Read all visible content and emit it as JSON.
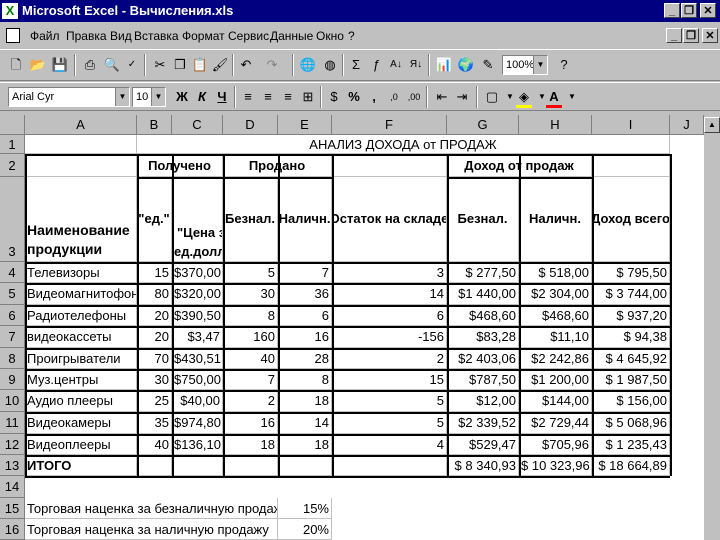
{
  "window": {
    "title": "Microsoft Excel - Вычисления.xls",
    "app_glyph": "X"
  },
  "window_buttons": {
    "minimize": "_",
    "restore": "❐",
    "close": "✕"
  },
  "menu": {
    "items": [
      "Файл",
      "Правка",
      "Вид",
      "Вставка",
      "Формат",
      "Сервис",
      "Данные",
      "Окно",
      "?"
    ]
  },
  "toolbar": {
    "zoom": "100%",
    "icons": [
      "new-icon",
      "open-icon",
      "save-icon",
      "print-icon",
      "preview-icon",
      "spelling-icon",
      "cut-icon",
      "copy-icon",
      "paste-icon",
      "format-painter-icon",
      "undo-icon",
      "redo-icon",
      "hyperlink-icon",
      "web-toolbar-icon",
      "autosum-icon",
      "function-icon",
      "sort-ascending-icon",
      "sort-descending-icon",
      "chart-wizard-icon",
      "map-icon",
      "drawing-icon",
      "help-icon"
    ]
  },
  "format": {
    "font": "Arial Cyr",
    "size": "10",
    "bold": "Ж",
    "italic": "К",
    "underline": "Ч",
    "percent": "%",
    "comma": ",",
    "fill_color": "#ffff00",
    "font_color": "#ff0000"
  },
  "columns": [
    "A",
    "B",
    "C",
    "D",
    "E",
    "F",
    "G",
    "H",
    "I",
    "J"
  ],
  "rows": [
    "1",
    "2",
    "3",
    "4",
    "5",
    "6",
    "7",
    "8",
    "9",
    "10",
    "11",
    "12",
    "13",
    "14",
    "15",
    "16"
  ],
  "sheet": {
    "title": "АНАЛИЗ ДОХОДА от ПРОДАЖ",
    "group_received": "Получено",
    "group_sold": "Продано",
    "group_income": "Доход от продаж",
    "h_name": "Наименование продукции",
    "h_units": "\"ед.\"",
    "h_price": "\"Цена за ед.долл.\"",
    "h_cashless": "Безнал.",
    "h_cash": "Наличн.",
    "h_stock": "Остаток на складе",
    "h_inc_cashless": "Безнал.",
    "h_inc_cash": "Наличн.",
    "h_total": "Доход всего",
    "products": [
      {
        "name": "Телевизоры",
        "units": "15",
        "price": "$370,00",
        "cashless": "5",
        "cash": "7",
        "stock": "3",
        "inc_cashless": "$ 277,50",
        "inc_cash": "$ 518,00",
        "total": "$ 795,50"
      },
      {
        "name": "Видеомагнитофоны",
        "units": "80",
        "price": "$320,00",
        "cashless": "30",
        "cash": "36",
        "stock": "14",
        "inc_cashless": "$1 440,00",
        "inc_cash": "$2 304,00",
        "total": "$ 3 744,00"
      },
      {
        "name": "Радиотелефоны",
        "units": "20",
        "price": "$390,50",
        "cashless": "8",
        "cash": "6",
        "stock": "6",
        "inc_cashless": "$468,60",
        "inc_cash": "$468,60",
        "total": "$ 937,20"
      },
      {
        "name": "видеокассеты",
        "units": "20",
        "price": "$3,47",
        "cashless": "160",
        "cash": "16",
        "stock": "-156",
        "inc_cashless": "$83,28",
        "inc_cash": "$11,10",
        "total": "$ 94,38"
      },
      {
        "name": "Проигрыватели",
        "units": "70",
        "price": "$430,51",
        "cashless": "40",
        "cash": "28",
        "stock": "2",
        "inc_cashless": "$2 403,06",
        "inc_cash": "$2 242,86",
        "total": "$ 4 645,92"
      },
      {
        "name": "Муз.центры",
        "units": "30",
        "price": "$750,00",
        "cashless": "7",
        "cash": "8",
        "stock": "15",
        "inc_cashless": "$787,50",
        "inc_cash": "$1 200,00",
        "total": "$ 1 987,50"
      },
      {
        "name": "Аудио плееры",
        "units": "25",
        "price": "$40,00",
        "cashless": "2",
        "cash": "18",
        "stock": "5",
        "inc_cashless": "$12,00",
        "inc_cash": "$144,00",
        "total": "$ 156,00"
      },
      {
        "name": "Видеокамеры",
        "units": "35",
        "price": "$974,80",
        "cashless": "16",
        "cash": "14",
        "stock": "5",
        "inc_cashless": "$2 339,52",
        "inc_cash": "$2 729,44",
        "total": "$ 5 068,96"
      },
      {
        "name": "Видеоплееры",
        "units": "40",
        "price": "$136,10",
        "cashless": "18",
        "cash": "18",
        "stock": "4",
        "inc_cashless": "$529,47",
        "inc_cash": "$705,96",
        "total": "$ 1 235,43"
      }
    ],
    "total_label": "ИТОГО",
    "total_cashless": "$ 8 340,93",
    "total_cash": "$ 10 323,96",
    "total_all": "$ 18 664,89",
    "markup_cashless_label": "Торговая наценка за безналичную продажу",
    "markup_cashless": "15%",
    "markup_cash_label": "Торговая наценка за наличную продажу",
    "markup_cash": "20%"
  }
}
